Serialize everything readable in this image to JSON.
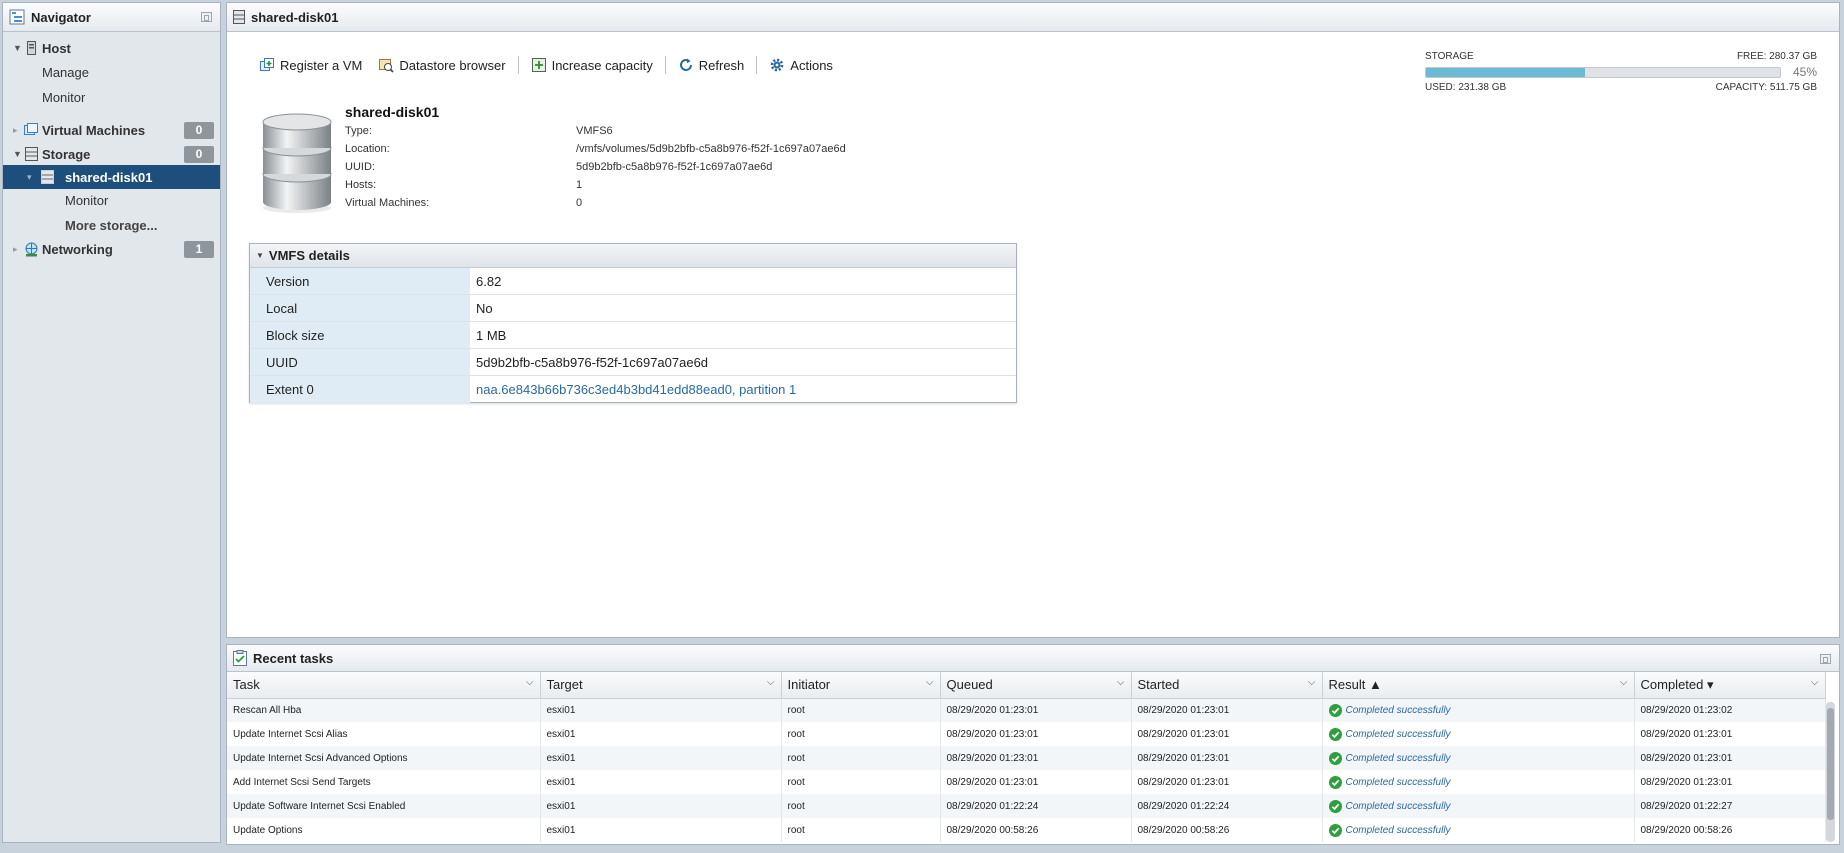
{
  "navigator": {
    "title": "Navigator",
    "items": [
      {
        "label": "Host"
      },
      {
        "label": "Manage"
      },
      {
        "label": "Monitor"
      },
      {
        "label": "Virtual Machines",
        "count": "0"
      },
      {
        "label": "Storage",
        "count": "0"
      },
      {
        "label": "shared-disk01"
      },
      {
        "label": "Monitor"
      },
      {
        "label": "More storage..."
      },
      {
        "label": "Networking",
        "count": "1"
      }
    ]
  },
  "main": {
    "title": "shared-disk01",
    "toolbar": {
      "register": "Register a VM",
      "browser": "Datastore browser",
      "increase": "Increase capacity",
      "refresh": "Refresh",
      "actions": "Actions"
    },
    "storage": {
      "label": "STORAGE",
      "free": "FREE: 280.37 GB",
      "percent": "45%",
      "used_fraction": 0.45,
      "used": "USED: 231.38 GB",
      "capacity": "CAPACITY: 511.75 GB"
    },
    "datastore": {
      "name": "shared-disk01",
      "props": [
        {
          "label": "Type:",
          "value": "VMFS6"
        },
        {
          "label": "Location:",
          "value": "/vmfs/volumes/5d9b2bfb-c5a8b976-f52f-1c697a07ae6d"
        },
        {
          "label": "UUID:",
          "value": "5d9b2bfb-c5a8b976-f52f-1c697a07ae6d"
        },
        {
          "label": "Hosts:",
          "value": "1"
        },
        {
          "label": "Virtual Machines:",
          "value": "0"
        }
      ]
    },
    "vmfs": {
      "title": "VMFS details",
      "rows": [
        {
          "key": "Version",
          "value": "6.82"
        },
        {
          "key": "Local",
          "value": "No"
        },
        {
          "key": "Block size",
          "value": "1 MB"
        },
        {
          "key": "UUID",
          "value": "5d9b2bfb-c5a8b976-f52f-1c697a07ae6d"
        },
        {
          "key": "Extent 0",
          "value": "naa.6e843b66b736c3ed4b3bd41edd88ead0, partition 1"
        }
      ]
    }
  },
  "tasks": {
    "title": "Recent tasks",
    "columns": [
      "Task",
      "Target",
      "Initiator",
      "Queued",
      "Started",
      "Result ▲",
      "Completed ▾"
    ],
    "rows": [
      {
        "task": "Rescan All Hba",
        "target": "esxi01",
        "initiator": "root",
        "queued": "08/29/2020 01:23:01",
        "started": "08/29/2020 01:23:01",
        "result": "Completed successfully",
        "completed": "08/29/2020 01:23:02"
      },
      {
        "task": "Update Internet Scsi Alias",
        "target": "esxi01",
        "initiator": "root",
        "queued": "08/29/2020 01:23:01",
        "started": "08/29/2020 01:23:01",
        "result": "Completed successfully",
        "completed": "08/29/2020 01:23:01"
      },
      {
        "task": "Update Internet Scsi Advanced Options",
        "target": "esxi01",
        "initiator": "root",
        "queued": "08/29/2020 01:23:01",
        "started": "08/29/2020 01:23:01",
        "result": "Completed successfully",
        "completed": "08/29/2020 01:23:01"
      },
      {
        "task": "Add Internet Scsi Send Targets",
        "target": "esxi01",
        "initiator": "root",
        "queued": "08/29/2020 01:23:01",
        "started": "08/29/2020 01:23:01",
        "result": "Completed successfully",
        "completed": "08/29/2020 01:23:01"
      },
      {
        "task": "Update Software Internet Scsi Enabled",
        "target": "esxi01",
        "initiator": "root",
        "queued": "08/29/2020 01:22:24",
        "started": "08/29/2020 01:22:24",
        "result": "Completed successfully",
        "completed": "08/29/2020 01:22:27"
      },
      {
        "task": "Update Options",
        "target": "esxi01",
        "initiator": "root",
        "queued": "08/29/2020 00:58:26",
        "started": "08/29/2020 00:58:26",
        "result": "Completed successfully",
        "completed": "08/29/2020 00:58:26"
      }
    ]
  },
  "colors": {
    "selected": "#1e4f7c",
    "meter_fill": "#6bbad6",
    "link": "#2a6aa3",
    "success": "#2e9e3e"
  }
}
